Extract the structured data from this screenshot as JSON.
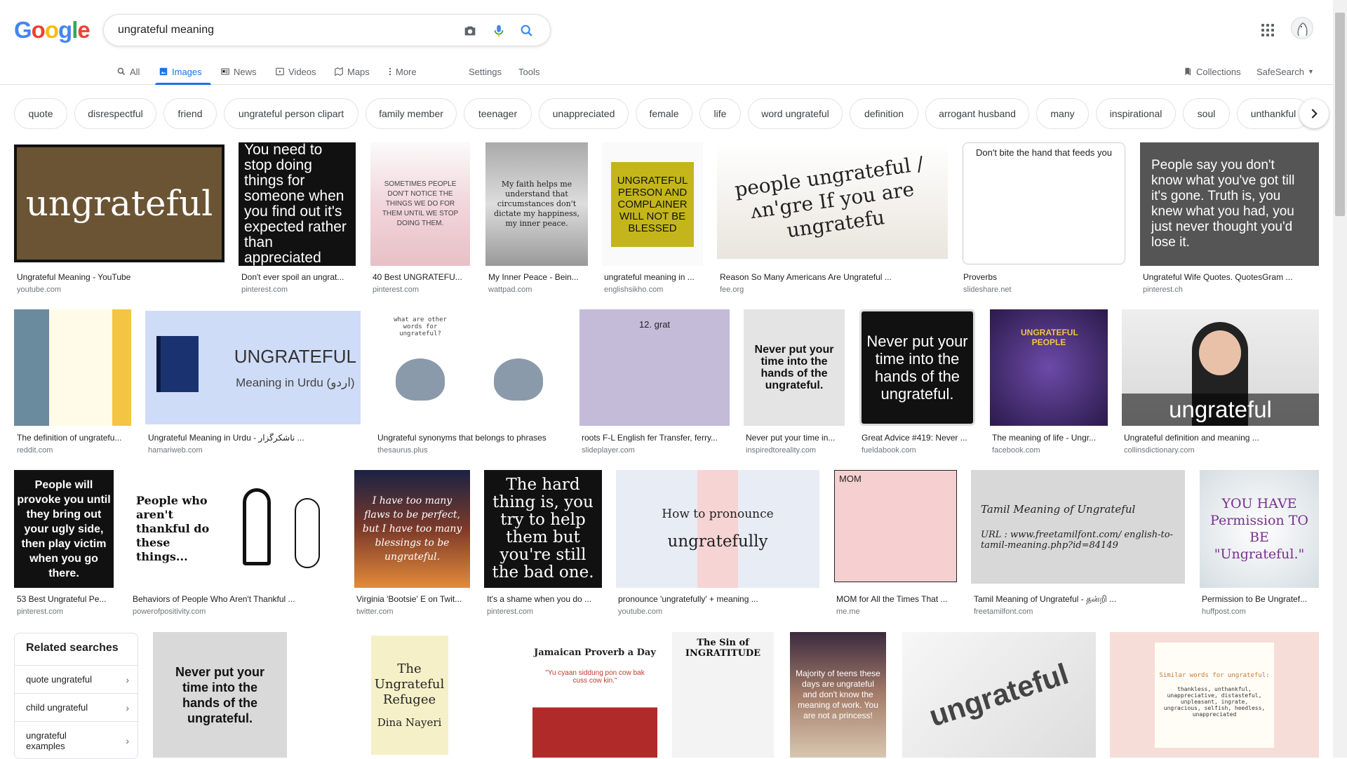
{
  "logo": [
    "G",
    "o",
    "o",
    "g",
    "l",
    "e"
  ],
  "search": {
    "value": "ungrateful meaning"
  },
  "tabs": [
    {
      "label": "All",
      "icon": "search-icon"
    },
    {
      "label": "Images",
      "icon": "image-icon"
    },
    {
      "label": "News",
      "icon": "news-icon"
    },
    {
      "label": "Videos",
      "icon": "video-icon"
    },
    {
      "label": "Maps",
      "icon": "map-icon"
    },
    {
      "label": "More",
      "icon": "more-vert-icon"
    },
    {
      "label": "Settings"
    },
    {
      "label": "Tools"
    }
  ],
  "header_right": {
    "collections": "Collections",
    "safesearch": "SafeSearch"
  },
  "chips": [
    "quote",
    "disrespectful",
    "friend",
    "ungrateful person clipart",
    "family member",
    "teenager",
    "unappreciated",
    "female",
    "life",
    "word ungrateful",
    "definition",
    "arrogant husband",
    "many",
    "inspirational",
    "soul",
    "unthankful"
  ],
  "row1": [
    {
      "caption": "Ungrateful Meaning - YouTube",
      "source": "youtube.com",
      "text": "ungrateful"
    },
    {
      "caption": "Don't ever spoil an ungrat...",
      "source": "pinterest.com",
      "text": "You need to stop doing things for someone when you find out it's expected rather than appreciated"
    },
    {
      "caption": "40 Best UNGRATEFU...",
      "source": "pinterest.com",
      "text": "SOMETIMES PEOPLE DON'T NOTICE THE THINGS WE DO FOR THEM UNTIL WE STOP DOING THEM."
    },
    {
      "caption": "My Inner Peace - Bein...",
      "source": "wattpad.com",
      "text": "My faith helps me understand that circumstances don't dictate my happiness, my inner peace."
    },
    {
      "caption": "ungrateful meaning in ...",
      "source": "englishsikho.com",
      "text": "UNGRATEFUL PERSON AND COMPLAINER WILL NOT BE BLESSED"
    },
    {
      "caption": "Reason So Many Americans Are Ungrateful ...",
      "source": "fee.org",
      "text": "people ungrateful / ʌn'gre If you are ungratefu"
    },
    {
      "caption": "Proverbs",
      "source": "slideshare.net",
      "text": "Don't bite the hand that feeds you"
    },
    {
      "caption": "Ungrateful Wife Quotes. QuotesGram ...",
      "source": "pinterest.ch",
      "text": "People say you don't know what you've got till it's gone. Truth is, you knew what you had, you just never thought you'd lose it."
    }
  ],
  "row2": [
    {
      "caption": "The definition of ungratefu...",
      "source": "reddit.com",
      "text": ""
    },
    {
      "caption": "Ungrateful Meaning in Urdu - ناشکرگزار ...",
      "source": "hamariweb.com",
      "text": "UNGRATEFUL",
      "subtext": "Meaning in Urdu (اردو)"
    },
    {
      "caption": "Ungrateful synonyms that belongs to phrases",
      "source": "thesaurus.plus",
      "text": "what are other words for ungrateful?"
    },
    {
      "caption": "roots F-L English fer Transfer, ferry...",
      "source": "slideplayer.com",
      "text": "12. grat"
    },
    {
      "caption": "Never put your time in...",
      "source": "inspiredtoreality.com",
      "text": "Never put your time into the hands of the ungrateful."
    },
    {
      "caption": "Great Advice #419: Never ...",
      "source": "fueldabook.com",
      "text": "Never put your time into the hands of the ungrateful."
    },
    {
      "caption": "The meaning of life - Ungr...",
      "source": "facebook.com",
      "text": "UNGRATEFUL PEOPLE"
    },
    {
      "caption": "Ungrateful definition and meaning ...",
      "source": "collinsdictionary.com",
      "text": "ungrateful"
    }
  ],
  "row3": [
    {
      "caption": "53 Best Ungrateful Pe...",
      "source": "pinterest.com",
      "text": "People will provoke you until they bring out your ugly side, then play victim when you go there."
    },
    {
      "caption": "Behaviors of People Who Aren't Thankful ...",
      "source": "powerofpositivity.com",
      "text": "People who aren't thankful do these things..."
    },
    {
      "caption": "Virginia 'Bootsie' E on Twit...",
      "source": "twitter.com",
      "text": "I have too many flaws to be perfect, but I have too many blessings to be ungrateful."
    },
    {
      "caption": "It's a shame when you do ...",
      "source": "pinterest.com",
      "text": "The hard thing is, you try to help them but you're still the bad one."
    },
    {
      "caption": "pronounce 'ungratefully' + meaning ...",
      "source": "youtube.com",
      "text": "How to pronounce",
      "subtext": "ungratefully"
    },
    {
      "caption": "MOM for All the Times That ...",
      "source": "me.me",
      "text": "MOM"
    },
    {
      "caption": "Tamil Meaning of Ungrateful - தன்றி ...",
      "source": "freetamilfont.com",
      "text": "Tamil Meaning of Ungrateful",
      "subtext": "URL : www.freetamilfont.com/ english-to-tamil-meaning.php?id=84149"
    },
    {
      "caption": "Permission to Be Ungratef...",
      "source": "huffpost.com",
      "text": "YOU HAVE Permission TO BE \"Ungrateful.\""
    }
  ],
  "row4": [
    {
      "text": "Never put your time into the hands of the ungrateful."
    },
    {
      "text": "The Ungrateful Refugee",
      "subtext": "Dina Nayeri"
    },
    {
      "text": "Jamaican Proverb a Day",
      "subtext": "\"Yu cyaan siddung pon cow bak cuss cow kin.\""
    },
    {
      "text": "The Sin of INGRATITUDE"
    },
    {
      "text": "Majority of teens these days are ungrateful and don't know the meaning of work. You are not a princess!"
    },
    {
      "text": "ungrateful"
    },
    {
      "text": "Similar words for ungrateful:",
      "subtext": "thankless, unthankful, unappreciative, distasteful, unpleasant, ingrate, ungracious, selfish, heedless, unappreciated"
    }
  ],
  "related": {
    "title": "Related searches",
    "items": [
      "quote ungrateful",
      "child ungrateful",
      "ungrateful examples"
    ]
  }
}
